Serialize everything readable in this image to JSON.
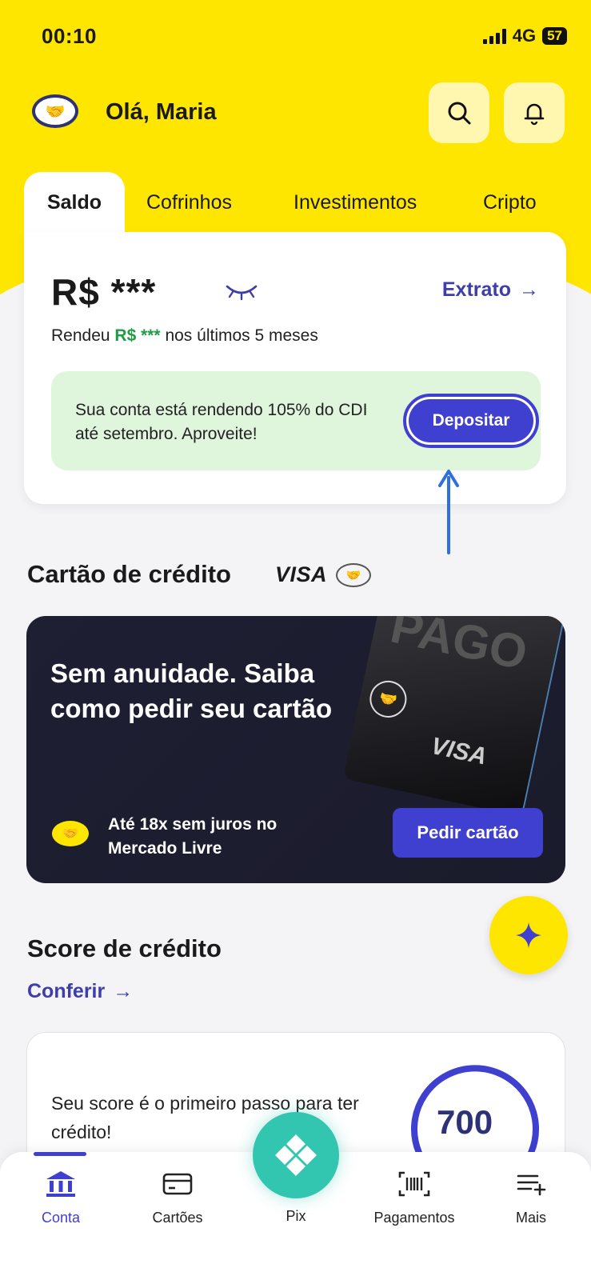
{
  "status": {
    "time": "00:10",
    "network": "4G",
    "battery": "57"
  },
  "header": {
    "greeting": "Olá, Maria"
  },
  "tabs": [
    {
      "label": "Saldo",
      "active": true
    },
    {
      "label": "Cofrinhos"
    },
    {
      "label": "Investimentos"
    },
    {
      "label": "Cripto"
    }
  ],
  "balance": {
    "amount": "R$ ***",
    "extrato_label": "Extrato",
    "yield_prefix": "Rendeu ",
    "yield_amount": "R$ ***",
    "yield_suffix": " nos últimos 5 meses",
    "promo_text": "Sua conta está rendendo 105% do CDI até setembro. Aproveite!",
    "deposit_label": "Depositar"
  },
  "credit_card": {
    "title": "Cartão de crédito",
    "brand": "VISA",
    "headline": "Sem anuidade. Saiba como pedir seu cartão",
    "card_text": "PAGO",
    "card_brand": "VISA",
    "installments_text": "Até 18x sem juros no Mercado Livre",
    "request_label": "Pedir cartão"
  },
  "score": {
    "title": "Score de crédito",
    "link_label": "Conferir",
    "description": "Seu score é o primeiro passo para ter crédito!",
    "value": "700"
  },
  "bottom_nav": [
    {
      "label": "Conta",
      "icon": "bank-icon",
      "active": true
    },
    {
      "label": "Cartões",
      "icon": "card-icon"
    },
    {
      "label": "Pix",
      "icon": "pix-icon"
    },
    {
      "label": "Pagamentos",
      "icon": "barcode-icon"
    },
    {
      "label": "Mais",
      "icon": "menu-plus-icon"
    }
  ],
  "colors": {
    "brand_yellow": "#ffe600",
    "accent_blue": "#3f3fd0",
    "pix_green": "#32c6b0",
    "yield_green": "#1f9d44"
  }
}
